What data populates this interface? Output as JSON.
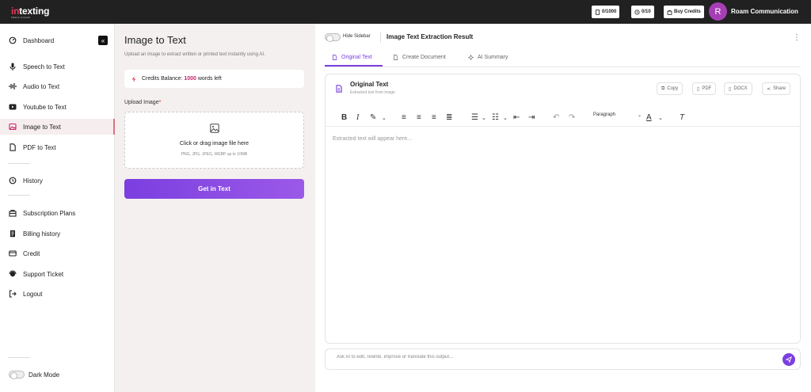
{
  "brand": {
    "logo_prefix": "in",
    "logo_suffix": "texting",
    "tagline": "MEDIA-SHARE"
  },
  "header": {
    "words_counter": "0/1000",
    "credits_counter": "0/10",
    "buy_credits_label": "Buy Credits",
    "avatar_initial": "R",
    "user_name": "Roam Communication"
  },
  "sidebar": {
    "items": [
      {
        "label": "Dashboard",
        "icon": "dashboard-icon"
      },
      {
        "label": "Speech to Text",
        "icon": "microphone-icon"
      },
      {
        "label": "Audio to Text",
        "icon": "audio-wave-icon"
      },
      {
        "label": "Youtube to Text",
        "icon": "youtube-icon"
      },
      {
        "label": "Image to Text",
        "icon": "image-icon"
      },
      {
        "label": "PDF to Text",
        "icon": "pdf-icon"
      },
      {
        "label": "History",
        "icon": "history-icon"
      },
      {
        "label": "Subscription Plans",
        "icon": "subscription-icon"
      },
      {
        "label": "Billing history",
        "icon": "billing-icon"
      },
      {
        "label": "Credit",
        "icon": "credit-card-icon"
      },
      {
        "label": "Support Ticket",
        "icon": "support-icon"
      },
      {
        "label": "Logout",
        "icon": "logout-icon"
      }
    ],
    "dark_mode_label": "Dark Mode"
  },
  "converter": {
    "title": "Image to Text",
    "subtitle": "Upload an image to extract written or printed text instantly using AI.",
    "credits_label": "Credits Balance:",
    "credits_value": "1000",
    "credits_suffix": "words left",
    "upload_label": "Upload Image",
    "required_mark": "*",
    "dropzone_title": "Click or drag image file here",
    "dropzone_formats": "PNG, JPG, JPEG, WEBP up to 10MB",
    "submit_label": "Get in Text"
  },
  "result": {
    "hide_sidebar_label": "Hide Sidebar",
    "title": "Image Text Extraction Result",
    "tabs": [
      {
        "label": "Original Text",
        "icon": "document-icon",
        "active": true
      },
      {
        "label": "Create Document",
        "icon": "file-icon"
      },
      {
        "label": "AI Summary",
        "icon": "sparkle-icon"
      }
    ],
    "editor_title": "Original Text",
    "editor_subtitle": "Extracted text from image",
    "actions": [
      "Copy",
      "PDF",
      "DOCX",
      "Share"
    ],
    "paragraph_select": "Paragraph",
    "placeholder": "Extracted text will appear here...",
    "ask_placeholder": "Ask AI to edit, rewrite, improve or translate this output..."
  },
  "colors": {
    "accent": "#7b3fe0",
    "brand_red": "#e23b5a",
    "credits_highlight": "#c8246a",
    "topbar": "#212121"
  }
}
